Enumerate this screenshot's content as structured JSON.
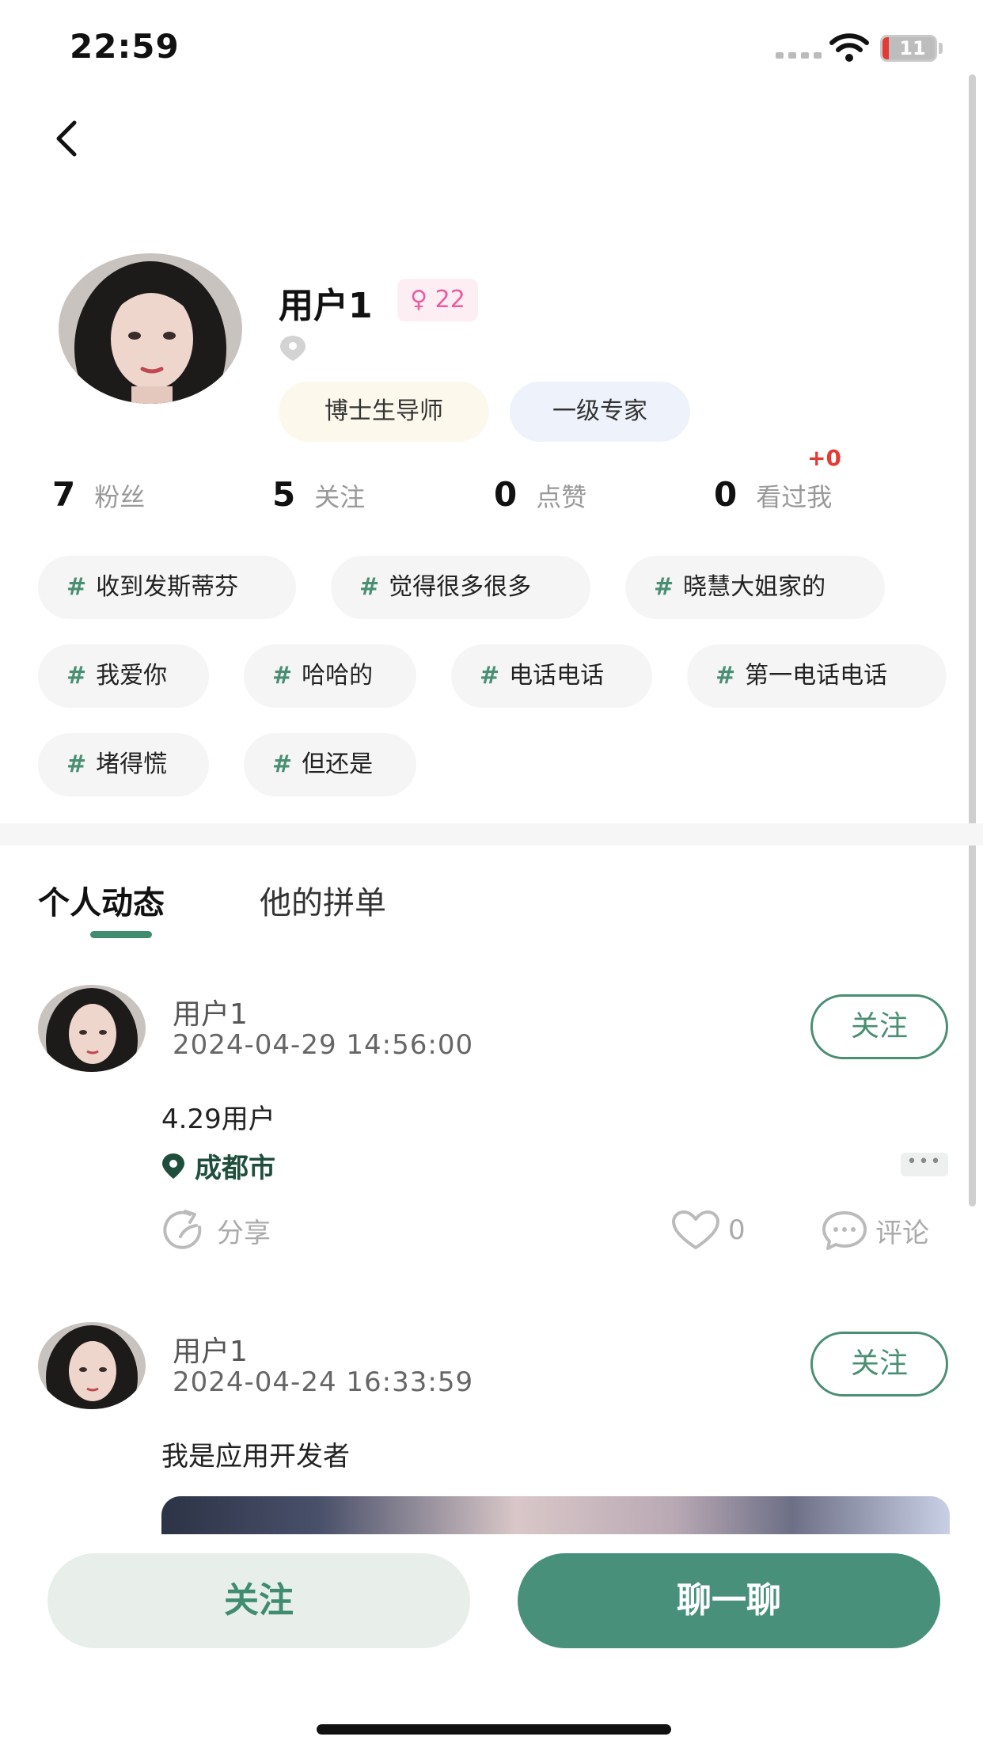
{
  "status_bar": {
    "time": "22:59",
    "battery": "11"
  },
  "profile": {
    "name": "用户1",
    "gender_age": "♀ 22",
    "titles": [
      "博士生导师",
      "一级专家"
    ]
  },
  "stats": [
    {
      "num": "7",
      "label": "粉丝"
    },
    {
      "num": "5",
      "label": "关注"
    },
    {
      "num": "0",
      "label": "点赞"
    },
    {
      "num": "0",
      "label": "看过我",
      "delta": "+0"
    }
  ],
  "tags": [
    {
      "hash": "#",
      "label": "收到发斯蒂芬"
    },
    {
      "hash": "#",
      "label": "觉得很多很多"
    },
    {
      "hash": "#",
      "label": "晓慧大姐家的"
    },
    {
      "hash": "#",
      "label": "我爱你"
    },
    {
      "hash": "#",
      "label": "哈哈的"
    },
    {
      "hash": "#",
      "label": "电话电话"
    },
    {
      "hash": "#",
      "label": "第一电话电话"
    },
    {
      "hash": "#",
      "label": "堵得慌"
    },
    {
      "hash": "#",
      "label": "但还是"
    }
  ],
  "tabs": {
    "active": "个人动态",
    "inactive": "他的拼单"
  },
  "posts": [
    {
      "user": "用户1",
      "time": "2024-04-29 14:56:00",
      "follow": "关注",
      "text": "4.29用户",
      "city": "成都市",
      "share": "分享",
      "likes": "0",
      "comment": "评论"
    },
    {
      "user": "用户1",
      "time": "2024-04-24 16:33:59",
      "follow": "关注",
      "text": "我是应用开发者"
    }
  ],
  "bottom": {
    "follow": "关注",
    "chat": "聊一聊"
  },
  "colors": {
    "accent": "#48907a",
    "accent_light": "#e8efeb",
    "pink": "#ec5d9f",
    "red": "#e53935"
  }
}
